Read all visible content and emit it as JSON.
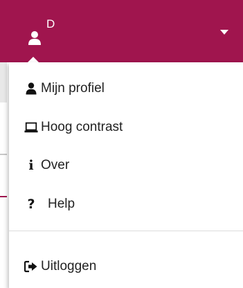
{
  "user_bar": {
    "initial": "D",
    "icon": "user-icon",
    "caret_icon": "caret-down-icon",
    "background_color": "#a0154e"
  },
  "menu": {
    "items": [
      {
        "label": "Mijn profiel",
        "icon": "user-icon"
      },
      {
        "label": "Hoog contrast",
        "icon": "laptop-icon"
      },
      {
        "label": "Over",
        "icon": "info-icon"
      },
      {
        "label": "Help",
        "icon": "question-icon"
      },
      {
        "label": "Uitloggen",
        "icon": "sign-out-icon"
      }
    ]
  }
}
